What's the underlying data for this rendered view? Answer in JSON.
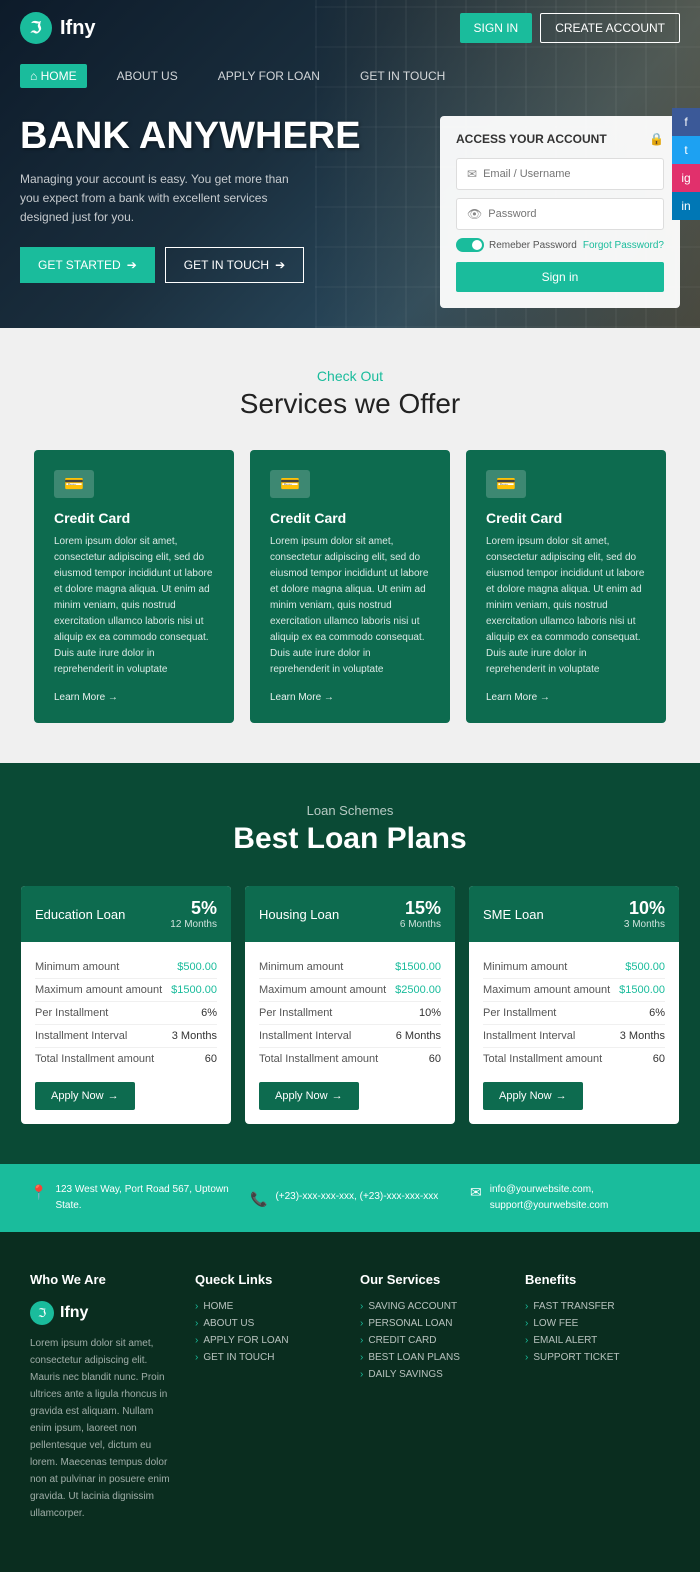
{
  "brand": {
    "name": "Ifny",
    "logo_char": "ℑ"
  },
  "header": {
    "signin_label": "SIGN IN",
    "create_label": "CREATE ACCOUNT"
  },
  "nav": {
    "items": [
      {
        "label": "HOME",
        "active": true,
        "icon": "⌂"
      },
      {
        "label": "ABOUT US",
        "active": false
      },
      {
        "label": "APPLY FOR LOAN",
        "active": false
      },
      {
        "label": "GET IN TOUCH",
        "active": false
      }
    ]
  },
  "hero": {
    "title": "BANK ANYWHERE",
    "subtitle": "Managing your account is easy. You get more than you expect from a bank with excellent services designed just for you.",
    "btn_started": "GET STARTED",
    "btn_touch": "GET IN TOUCH"
  },
  "login_form": {
    "title": "ACCESS YOUR ACCOUNT",
    "email_placeholder": "Email / Username",
    "password_placeholder": "Password",
    "remember_label": "Remeber Password",
    "forgot_label": "Forgot Password?",
    "signin_label": "Sign in"
  },
  "services": {
    "subtitle": "Check Out",
    "title": "Services we Offer",
    "cards": [
      {
        "title": "Credit Card",
        "text": "Lorem ipsum dolor sit amet, consectetur adipiscing elit, sed do eiusmod tempor incididunt ut labore et dolore magna aliqua. Ut enim ad minim veniam, quis nostrud exercitation ullamco laboris nisi ut aliquip ex ea commodo consequat. Duis aute irure dolor in reprehenderit in voluptate",
        "link": "Learn More"
      },
      {
        "title": "Credit Card",
        "text": "Lorem ipsum dolor sit amet, consectetur adipiscing elit, sed do eiusmod tempor incididunt ut labore et dolore magna aliqua. Ut enim ad minim veniam, quis nostrud exercitation ullamco laboris nisi ut aliquip ex ea commodo consequat. Duis aute irure dolor in reprehenderit in voluptate",
        "link": "Learn More"
      },
      {
        "title": "Credit Card",
        "text": "Lorem ipsum dolor sit amet, consectetur adipiscing elit, sed do eiusmod tempor incididunt ut labore et dolore magna aliqua. Ut enim ad minim veniam, quis nostrud exercitation ullamco laboris nisi ut aliquip ex ea commodo consequat. Duis aute irure dolor in reprehenderit in voluptate",
        "link": "Learn More"
      }
    ]
  },
  "loans": {
    "subtitle": "Loan Schemes",
    "title": "Best Loan Plans",
    "plans": [
      {
        "name": "Education Loan",
        "rate": "5%",
        "period": "12 Months",
        "min_amount": "$500.00",
        "max_amount": "$1500.00",
        "installment_pct": "6%",
        "interval": "3 Months",
        "total_installment": "60",
        "apply_label": "Apply Now"
      },
      {
        "name": "Housing Loan",
        "rate": "15%",
        "period": "6 Months",
        "min_amount": "$1500.00",
        "max_amount": "$2500.00",
        "installment_pct": "10%",
        "interval": "6 Months",
        "total_installment": "60",
        "apply_label": "Apply Now"
      },
      {
        "name": "SME Loan",
        "rate": "10%",
        "period": "3 Months",
        "min_amount": "$500.00",
        "max_amount": "$1500.00",
        "installment_pct": "6%",
        "interval": "3 Months",
        "total_installment": "60",
        "apply_label": "Apply Now"
      }
    ],
    "row_labels": {
      "min": "Minimum amount",
      "max": "Maximum amount amount",
      "installment": "Per Installment",
      "interval": "Installment Interval",
      "total": "Total Installment amount"
    }
  },
  "contact": {
    "address_icon": "📍",
    "address": "123 West Way, Port Road 567, Uptown State.",
    "phone_icon": "📞",
    "phones": "(+23)-xxx-xxx-xxx, (+23)-xxx-xxx-xxx",
    "email_icon": "✉",
    "emails": "info@yourwebsite.com, support@yourwebsite.com"
  },
  "footer": {
    "about_title": "Who We Are",
    "about_desc": "Lorem ipsum dolor sit amet, consectetur adipiscing elit. Mauris nec blandit nunc. Proin ultrices ante a ligula rhoncus in gravida est aliquam. Nullam enim ipsum, laoreet non pellentesque vel, dictum eu lorem. Maecenas tempus dolor non at pulvinar in posuere enim gravida. Ut lacinia dignissim ullamcorper.",
    "links_title": "Queck Links",
    "links": [
      "HOME",
      "ABOUT US",
      "APPLY FOR LOAN",
      "GET IN TOUCH"
    ],
    "services_title": "Our Services",
    "services": [
      "SAVING ACCOUNT",
      "PERSONAL LOAN",
      "CREDIT CARD",
      "BEST LOAN PLANS",
      "DAILY SAVINGS"
    ],
    "benefits_title": "Benefits",
    "benefits": [
      "FAST TRANSFER",
      "LOW FEE",
      "EMAIL ALERT",
      "SUPPORT TICKET"
    ]
  },
  "social": {
    "facebook": "f",
    "twitter": "t",
    "instagram": "ig",
    "linkedin": "in"
  }
}
